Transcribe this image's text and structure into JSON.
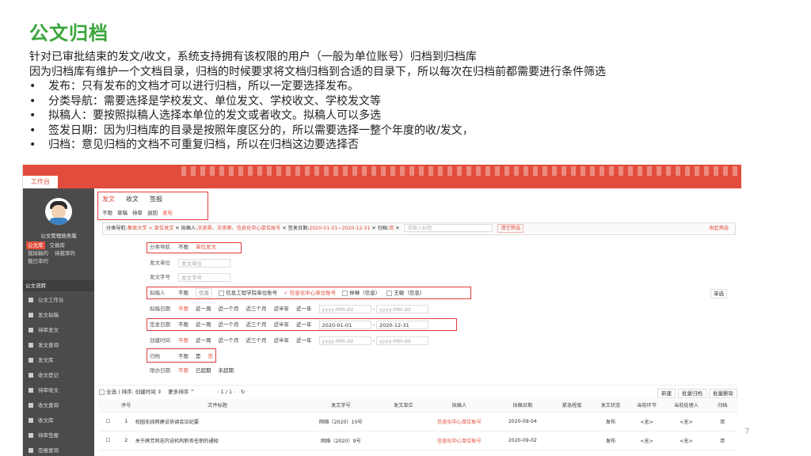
{
  "slide": {
    "title": "公文归档",
    "intro": [
      "针对已审批结束的发文/收文，系统支持拥有该权限的用户（一般为单位账号）归档到归档库",
      "因为归档库有维护一个文档目录，归档的时候要求将文档归档到合适的目录下，所以每次在归档前都需要进行条件筛选"
    ],
    "bullets": [
      "发布：只有发布的文档才可以进行归档，所以一定要选择发布。",
      "分类导航：需要选择是学校发文、单位发文、学校收文、学校发文等",
      "拟稿人：要按照拟稿人选择本单位的发文或者收文。拟稿人可以多选",
      "签发日期：因为归档库的目录是按照年度区分的，所以需要选择一整个年度的收/发文，",
      "归档：意见归档的文档不可重复归档，所以在归档这边要选择否"
    ],
    "page_number": "7"
  },
  "app": {
    "top_tab": "工作台",
    "sidebar": {
      "account": "公文管理政务版",
      "quick": [
        "公文库",
        "交换库",
        "我拟稿的",
        "待我审的",
        "我已审的"
      ],
      "group": "公文流转",
      "menu": [
        "公文工作台",
        "发文拟稿",
        "待审发文",
        "发文查询",
        "发文库",
        "收文登记",
        "待审收文",
        "收文查询",
        "收文库",
        "待审签报",
        "签报查询"
      ]
    },
    "doc_tabs": [
      "发文",
      "收文",
      "签报"
    ],
    "status_tabs": [
      "不限",
      "草稿",
      "待审",
      "退回",
      "发布"
    ],
    "filter_bar": {
      "nav_label": "分类导航:",
      "nav_value": "集美大学 > 单位发文",
      "drafter_label": "拟稿人:",
      "drafter_value": "王崇翠、王崇蔡、信息化中心单位账号",
      "date_label": "签发日期:",
      "date_value": "2020-01-01~2020-12-31",
      "archive_label": "归档:",
      "archive_value": "否",
      "search_placeholder": "请输入标题",
      "clear_label": "清空筛选",
      "collapse_label": "收起筛选"
    },
    "filters": {
      "category": {
        "label": "分类导航",
        "opt_all": "不限",
        "selected": "单位发文"
      },
      "unit": {
        "label": "发文单位",
        "placeholder": "发文单位"
      },
      "docno": {
        "label": "发文字号",
        "placeholder": "发文字号"
      },
      "drafter": {
        "label": "拟稿人",
        "opt_all": "不限",
        "search": "信息",
        "options": [
          "信息工程学院单位账号",
          "信息化中心单位账号",
          "林琳（信息）",
          "王敏（信息）"
        ],
        "confirm": "单选"
      },
      "draft_date": {
        "label": "拟稿日期"
      },
      "issue_date": {
        "label": "签发日期",
        "start": "2020-01-01",
        "end": "2020-12-31"
      },
      "create_date": {
        "label": "创建时间"
      },
      "archive": {
        "label": "归档",
        "opt_all": "不限",
        "yes": "是",
        "no": "否"
      },
      "deadline": {
        "label": "限办日期",
        "opt_all": "不限",
        "expired": "已超期",
        "not_expired": "未超期"
      },
      "date_options": [
        "不限",
        "近一周",
        "近一个月",
        "近三个月",
        "近半年",
        "近一年"
      ],
      "date_placeholder": "yyyy-MM-dd"
    },
    "toolbar": {
      "select_all": "全选",
      "sort_label": "排序:",
      "sort_value": "创建时间 ⇕",
      "more_sort": "更多排序 ^",
      "pager": "1 / 1",
      "buttons": [
        "新建",
        "批量归档",
        "批量删除"
      ]
    },
    "table": {
      "headers": [
        "序号",
        "文件标题",
        "发文字号",
        "发文单位",
        "拟稿人",
        "拟稿日期",
        "紧急程度",
        "发文状态",
        "当前环节",
        "当前处理人",
        "归档"
      ],
      "rows": [
        {
          "no": "1",
          "title": "校园无线网建设协调会议纪要",
          "docno": "网络〔2020〕10号",
          "unit": "",
          "drafter": "信息化中心单位账号",
          "date": "2020-09-04",
          "urgency": "",
          "status": "发布",
          "step": "<无>",
          "handler": "<无>",
          "archived": "否"
        },
        {
          "no": "2",
          "title": "关于薛芳同志内设机构职务任职的通知",
          "docno": "网络〔2020〕9号",
          "unit": "",
          "drafter": "信息化中心单位账号",
          "date": "2020-09-02",
          "urgency": "",
          "status": "发布",
          "step": "<无>",
          "handler": "<无>",
          "archived": "否"
        }
      ]
    }
  },
  "colors": {
    "title_green": "#3aa53a",
    "brand_red": "#e24c3c",
    "sidebar": "#4b4b4b",
    "highlight_box": "#e23b3b"
  }
}
